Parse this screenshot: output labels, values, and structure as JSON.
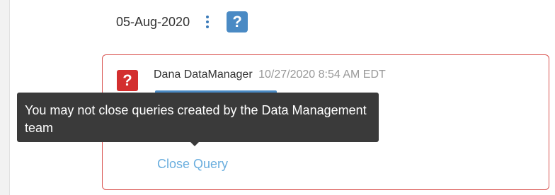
{
  "query_header": {
    "date": "05-Aug-2020",
    "help_icon_text": "?"
  },
  "query": {
    "icon_text": "?",
    "author": "Dana DataManager",
    "timestamp": "10/27/2020 8:54 AM EDT",
    "close_label": "Close Query"
  },
  "tooltip": {
    "text": "You may not close queries created by the Data Management team"
  },
  "icons": {
    "menu": "kebab-menu-icon",
    "help": "help-icon",
    "query_status": "question-mark-icon"
  },
  "colors": {
    "accent_blue": "#4a8ac4",
    "query_red": "#d9534f",
    "link_blue": "#6aaede",
    "tooltip_bg": "#3a3a3a"
  }
}
